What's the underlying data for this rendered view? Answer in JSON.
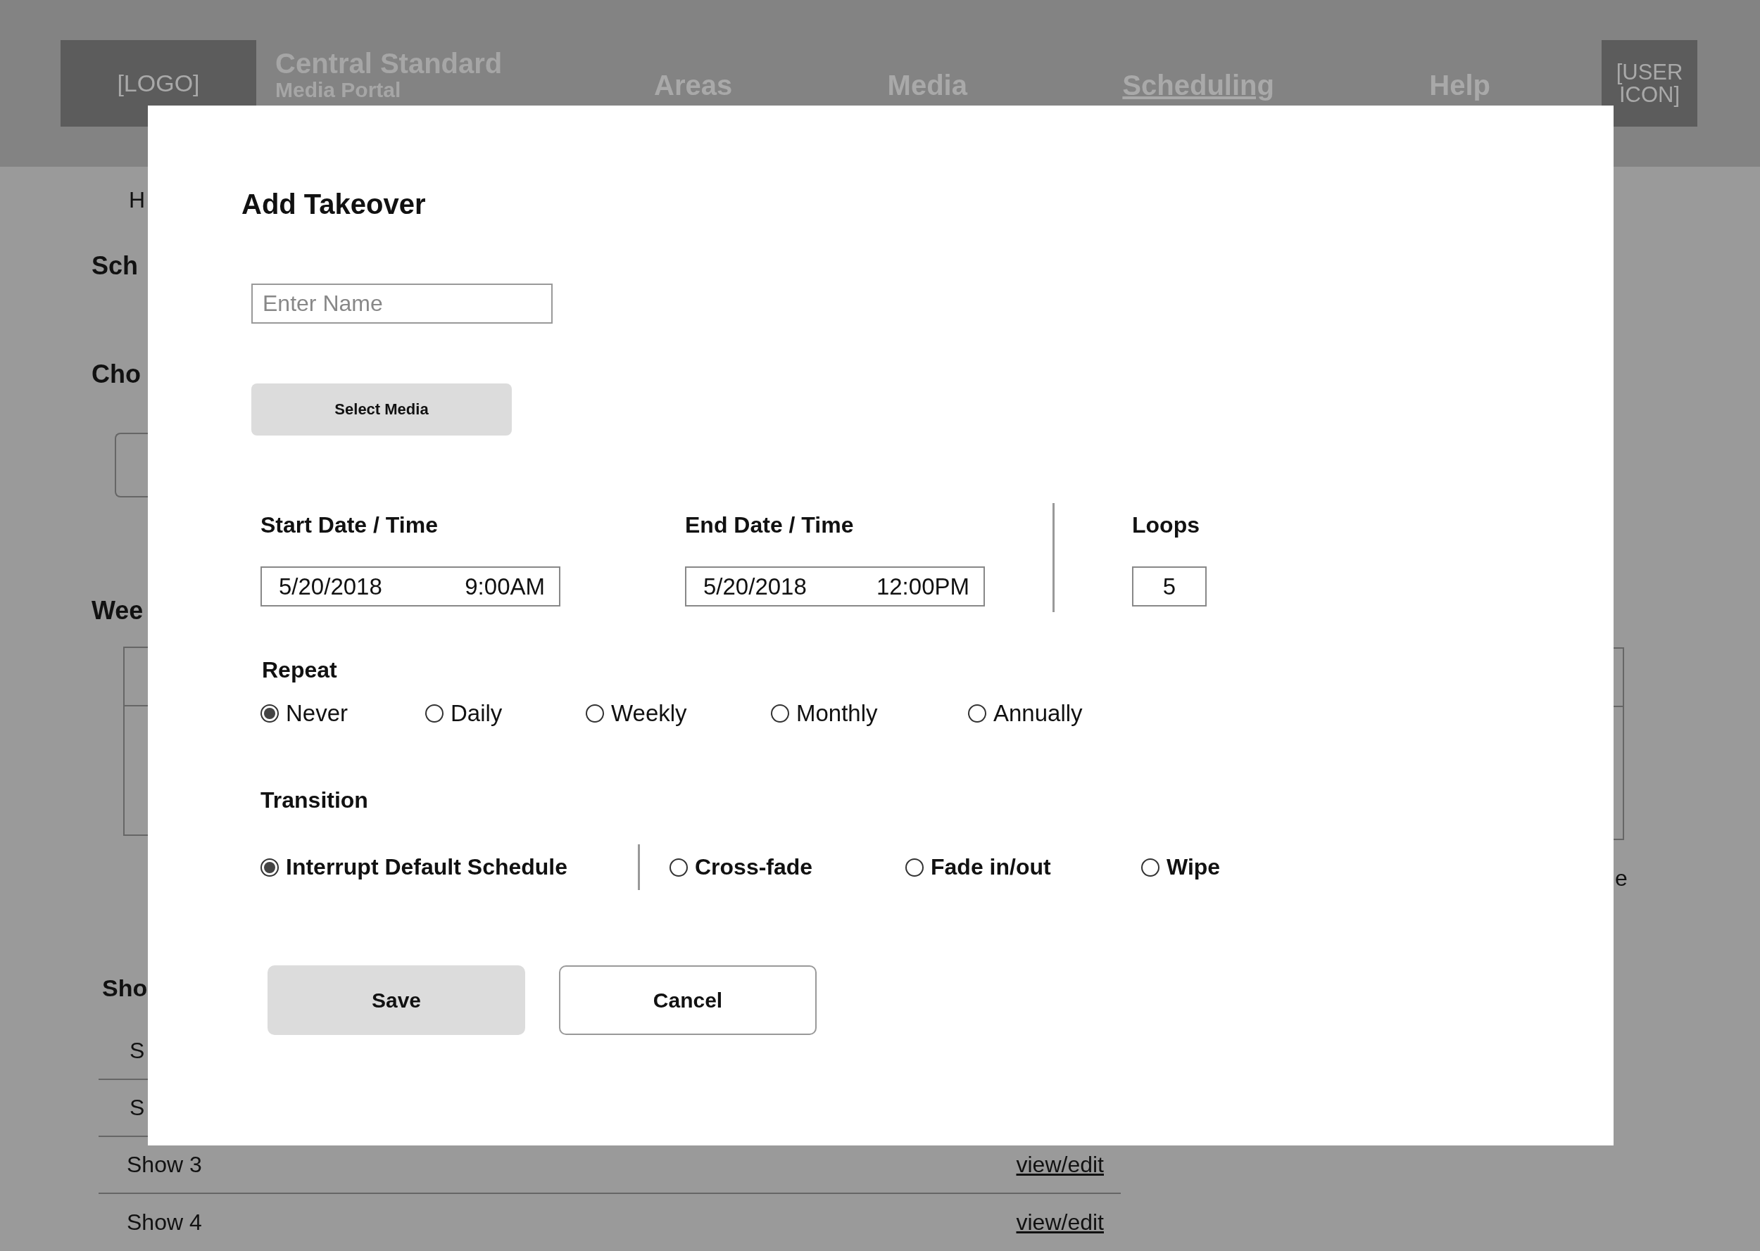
{
  "header": {
    "logo": "[LOGO]",
    "title": "Central Standard",
    "subtitle": "Media Portal",
    "nav": [
      {
        "label": "Areas",
        "selected": false
      },
      {
        "label": "Media",
        "selected": false
      },
      {
        "label": "Scheduling",
        "selected": true
      },
      {
        "label": "Help",
        "selected": false
      }
    ],
    "user": "[USER ICON]"
  },
  "page": {
    "crumb": "H",
    "section_1": "Sch",
    "section_2": "Cho",
    "section_3": "Wee",
    "section_4": "Sho",
    "show_rows": [
      {
        "name": "S"
      },
      {
        "name": "S"
      },
      {
        "name": "Show 3",
        "link": "view/edit"
      },
      {
        "name": "Show 4",
        "link": "view/edit"
      }
    ],
    "right_text": "e"
  },
  "dialog": {
    "title": "Add Takeover",
    "name_field": {
      "placeholder": "Enter Name"
    },
    "select_button": "Select Media",
    "start": {
      "label": "Start Date / Time",
      "date": "5/20/2018",
      "time": "9:00AM"
    },
    "end": {
      "label": "End Date / Time",
      "date": "5/20/2018",
      "time": "12:00PM"
    },
    "loops": {
      "label": "Loops",
      "value": "5"
    },
    "repeat": {
      "label": "Repeat",
      "options": [
        {
          "label": "Never",
          "selected": true
        },
        {
          "label": "Daily",
          "selected": false
        },
        {
          "label": "Weekly",
          "selected": false
        },
        {
          "label": "Monthly",
          "selected": false
        },
        {
          "label": "Annually",
          "selected": false
        }
      ]
    },
    "transition": {
      "label": "Transition",
      "options": [
        {
          "label": "Interrupt Default Schedule",
          "selected": true
        },
        {
          "label": "Cross-fade",
          "selected": false
        },
        {
          "label": "Fade in/out",
          "selected": false
        },
        {
          "label": "Wipe",
          "selected": false
        }
      ]
    },
    "buttons": [
      {
        "label": "Save",
        "kind": "primary"
      },
      {
        "label": "Cancel",
        "kind": "secondary"
      }
    ]
  }
}
